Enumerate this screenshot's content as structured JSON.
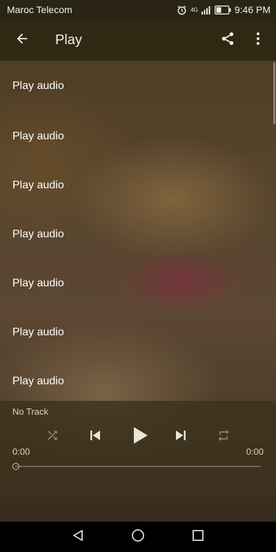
{
  "status_bar": {
    "carrier": "Maroc Telecom",
    "network": "4G",
    "time": "9:46 PM",
    "icons": [
      "alarm-icon",
      "signal-icon",
      "battery-icon"
    ]
  },
  "app_bar": {
    "title": "Play",
    "icons": [
      "back-arrow-icon",
      "share-icon",
      "more-vert-icon"
    ]
  },
  "list": {
    "items": [
      {
        "label": "Play audio"
      },
      {
        "label": "Play audio"
      },
      {
        "label": "Play audio"
      },
      {
        "label": "Play audio"
      },
      {
        "label": "Play audio"
      },
      {
        "label": "Play audio"
      },
      {
        "label": "Play audio"
      }
    ]
  },
  "player": {
    "track": "No Track",
    "elapsed": "0:00",
    "duration": "0:00",
    "progress": 0,
    "controls": [
      "shuffle-icon",
      "previous-icon",
      "play-icon",
      "next-icon",
      "repeat-icon"
    ]
  },
  "nav_bar": {
    "icons": [
      "back-triangle-icon",
      "home-circle-icon",
      "recents-square-icon"
    ]
  },
  "colors": {
    "status_bar": "#2a2414",
    "app_bar": "#2f2914",
    "player_bg": "#3a321c",
    "text": "#ffffff"
  }
}
